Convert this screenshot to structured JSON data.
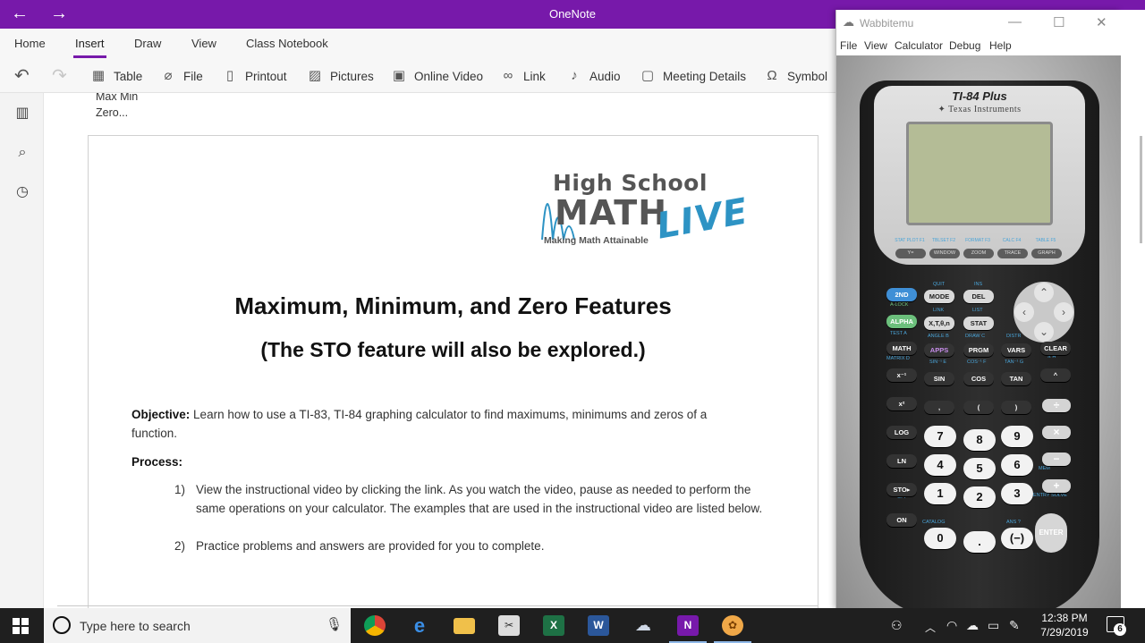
{
  "onenote": {
    "app_title": "OneNote",
    "tabs": [
      {
        "label": "Home"
      },
      {
        "label": "Insert"
      },
      {
        "label": "Draw"
      },
      {
        "label": "View"
      },
      {
        "label": "Class Notebook"
      }
    ],
    "active_tab": "Insert",
    "toolbar": {
      "table": "Table",
      "file": "File",
      "printout": "Printout",
      "pictures": "Pictures",
      "online_video": "Online Video",
      "link": "Link",
      "audio": "Audio",
      "meeting_details": "Meeting Details",
      "symbol": "Symbol"
    },
    "page": {
      "note_line1": "Max Min",
      "note_line2": "Zero..."
    },
    "document": {
      "logo_high_school": "High School",
      "logo_math": "MATH",
      "logo_live": "LIVE",
      "logo_tagline": "Making Math Attainable",
      "title": "Maximum, Minimum, and Zero Features",
      "subtitle": "(The STO feature will also be explored.)",
      "objective_label": "Objective:",
      "objective_text_1": "Learn how to use a TI-83, TI-84 graphing calculator to find maximums, minimums and zeros of a",
      "objective_text_2": "function.",
      "process_label": "Process:",
      "step1_num": "1)",
      "step1_text": "View the instructional video by clicking the link.  As you watch the video, pause as needed to perform the same operations on your calculator.  The examples that are used in the instructional video are listed below.",
      "step2_num": "2)",
      "step2_text": "Practice problems and answers are provided for you to complete."
    }
  },
  "wabbitemu": {
    "title": "Wabbitemu",
    "menu": [
      "File",
      "View",
      "Calculator",
      "Debug",
      "Help"
    ],
    "calculator": {
      "model": "TI-84 Plus",
      "brand": "Texas Instruments",
      "function_keys": [
        {
          "label": "Y=",
          "second": "STAT PLOT F1"
        },
        {
          "label": "WINDOW",
          "second": "TBLSET F2"
        },
        {
          "label": "ZOOM",
          "second": "FORMAT F3"
        },
        {
          "label": "TRACE",
          "second": "CALC F4"
        },
        {
          "label": "GRAPH",
          "second": "TABLE F5"
        }
      ],
      "keys": {
        "second": "2ND",
        "mode": "MODE",
        "del": "DEL",
        "alpha": "ALPHA",
        "xton": "X,T,θ,n",
        "stat": "STAT",
        "math": "MATH",
        "apps": "APPS",
        "prgm": "PRGM",
        "vars": "VARS",
        "clear": "CLEAR",
        "inv": "x⁻¹",
        "sin": "SIN",
        "cos": "COS",
        "tan": "TAN",
        "pow": "^",
        "sq": "x²",
        "comma": ",",
        "lparen": "(",
        "rparen": ")",
        "div": "÷",
        "log": "LOG",
        "seven": "7",
        "eight": "8",
        "nine": "9",
        "mul": "×",
        "ln": "LN",
        "four": "4",
        "five": "5",
        "six": "6",
        "sub": "−",
        "sto": "STO▸",
        "one": "1",
        "two": "2",
        "three": "3",
        "add": "+",
        "on": "ON",
        "zero": "0",
        "dot": ".",
        "neg": "(−)",
        "enter": "ENTER"
      },
      "second_labels": {
        "quit": "QUIT",
        "ins": "INS",
        "alock": "A-LOCK",
        "link": "LINK",
        "list": "LIST",
        "test": "TEST A",
        "angle": "ANGLE B",
        "draw": "DRAW C",
        "distr": "DISTR",
        "matrix": "MATRIX D",
        "sin_inv": "SIN⁻¹ E",
        "cos_inv": "COS⁻¹ F",
        "tan_inv": "TAN⁻¹ G",
        "pi": "π H",
        "ten_x": "10ˣ N",
        "e_x": "eˣ S",
        "rcl": "RCL X",
        "off": "OFF",
        "catalog": "CATALOG",
        "ans": "ANS ?",
        "mem": "MEM",
        "entry_solve": "ENTRY SOLVE"
      }
    }
  },
  "taskbar": {
    "search_placeholder": "Type here to search",
    "time": "12:38 PM",
    "date": "7/29/2019",
    "notification_count": "6"
  }
}
